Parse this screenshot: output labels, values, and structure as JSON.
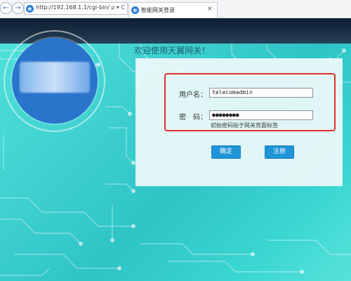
{
  "browser": {
    "address": "http://192.168.1.1/cgi-bin/",
    "address_controls": "ρ ▾ C",
    "tab_title": "智能网关登录",
    "tab_close": "×",
    "back_icon": "back-arrow-icon",
    "forward_icon": "forward-arrow-icon"
  },
  "page": {
    "welcome": "欢迎使用天翼网关！"
  },
  "login": {
    "username_label": "用户名：",
    "username_value": "telecomadmin",
    "password_label": "密　码：",
    "password_value": "●●●●●●●●",
    "hint": "初始密码贴于网关背面标签",
    "ok_label": "确定",
    "cancel_label": "注册"
  },
  "colors": {
    "accent_teal": "#3fd0d0",
    "header_dark": "#1b3146",
    "button_blue": "#1f94d6",
    "highlight_red": "#e0312a",
    "logo_blue": "#2a74cc"
  }
}
